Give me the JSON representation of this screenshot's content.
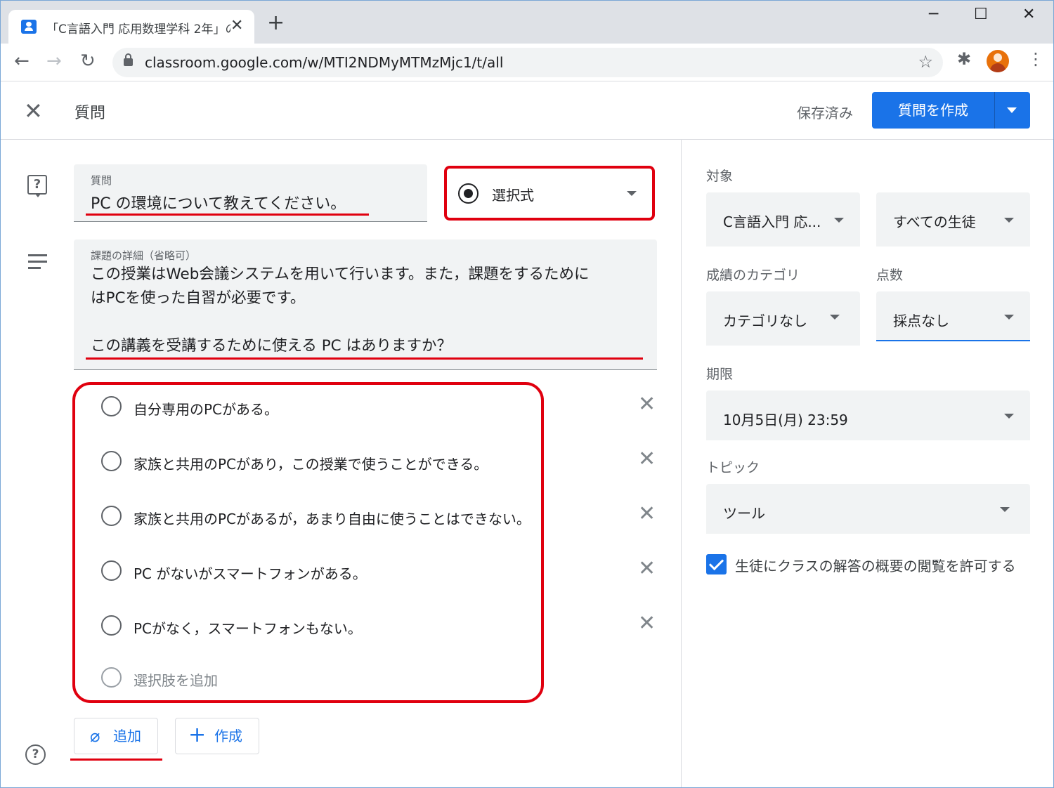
{
  "browser": {
    "tab_title": "「C言語入門 応用数理学科 2年」の",
    "tab_close": "✕",
    "new_tab": "+",
    "minimize": "─",
    "maximize": "☐",
    "close": "✕",
    "back": "←",
    "forward": "→",
    "reload": "↻",
    "url": "classroom.google.com/w/MTI2NDMyMTMzMjc1/t/all",
    "bookmark": "☆",
    "extensions": "✱",
    "menu": "⋮"
  },
  "header": {
    "close_icon": "✕",
    "title": "質問",
    "status": "保存済み",
    "create_button": "質問を作成"
  },
  "question": {
    "label": "質問",
    "value": "PC の環境について教えてください。",
    "type": "選択式",
    "details_label": "課題の詳細（省略可）",
    "details_value": "この授業はWeb会議システムを用いて行います。また，課題をするために\nはPCを使った自習が必要です。\n\nこの講義を受講するために使える PC はありますか？"
  },
  "options": [
    "自分専用のPCがある。",
    "家族と共用のPCがあり，この授業で使うことができる。",
    "家族と共用のPCがあるが，あまり自由に使うことはできない。",
    "PC がないがスマートフォンがある。",
    "PCがなく，スマートフォンもない。"
  ],
  "option_remove": "✕",
  "add_option": "選択肢を追加",
  "buttons": {
    "attach": "追加",
    "attach_icon": "𝟘",
    "create": "作成",
    "create_icon": "+"
  },
  "help_icon": "?",
  "sidebar": {
    "for_label": "対象",
    "class": "C言語入門 応...",
    "students": "すべての生徒",
    "grade_category_label": "成績のカテゴリ",
    "grade_category": "カテゴリなし",
    "points_label": "点数",
    "points": "採点なし",
    "due_label": "期限",
    "due": "10月5日(月) 23:59",
    "topic_label": "トピック",
    "topic": "ツール",
    "allow_summary": "生徒にクラスの解答の概要の閲覧を許可する"
  },
  "colors": {
    "accent": "#1a73e8",
    "annotation": "#e0000f"
  }
}
